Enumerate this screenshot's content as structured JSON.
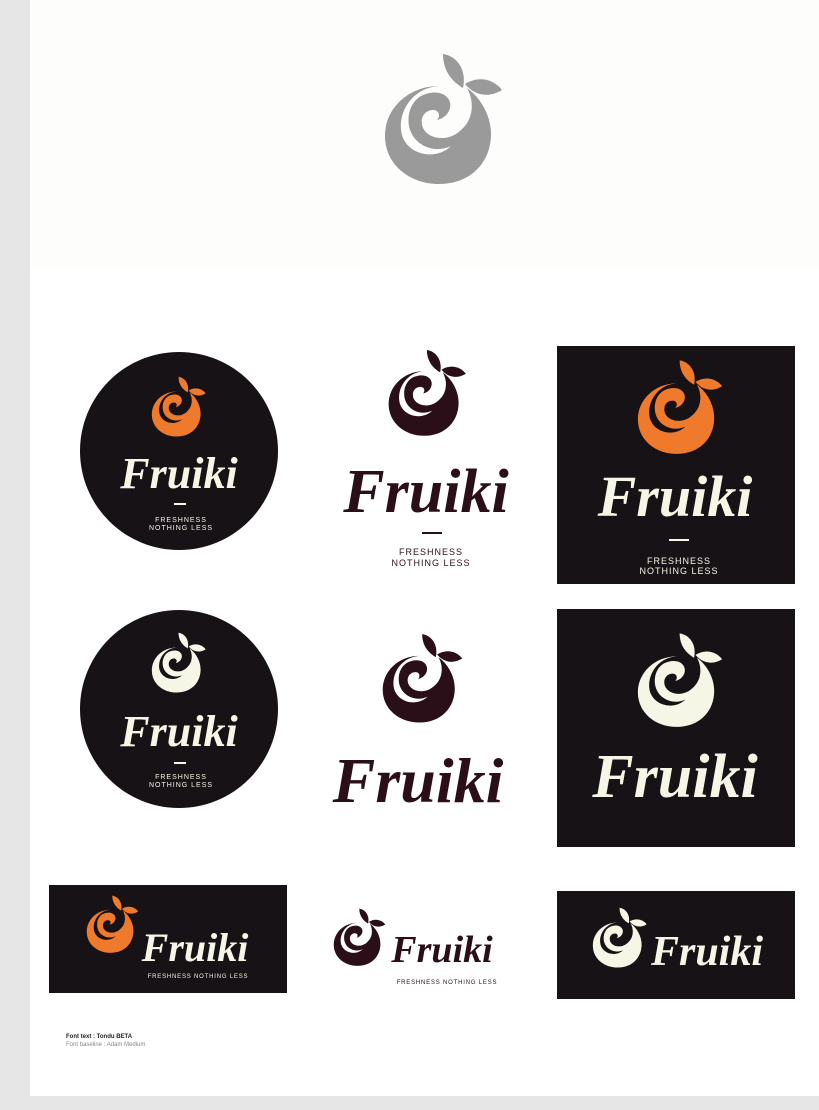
{
  "brand": {
    "name": "Fruiki",
    "tagline_line1": "FRESHNESS",
    "tagline_line2": "NOTHING LESS",
    "tagline_full": "FRESHNESS NOTHING LESS"
  },
  "colors": {
    "orange": "#ef7a2c",
    "cream": "#f6f6e6",
    "dark": "#171215",
    "maroon": "#2b0f18",
    "grey": "#9a9a9a"
  },
  "icons": [
    "fruit-logo-icon"
  ],
  "credits": {
    "font_text": "Font text : Tondu BETA",
    "font_baseline": "Font baseline : Adam Medium"
  }
}
